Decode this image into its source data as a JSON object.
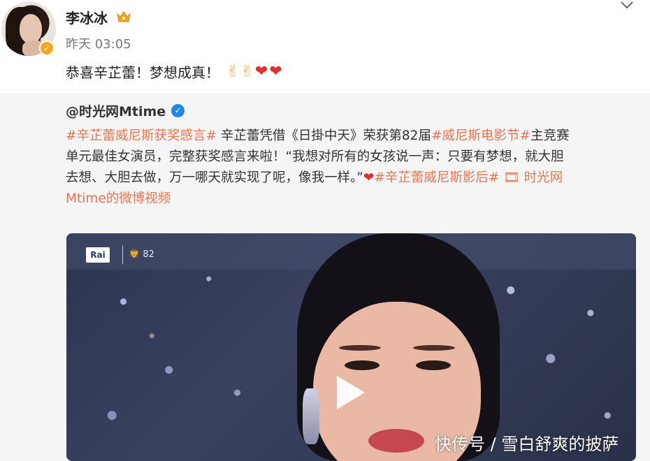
{
  "post": {
    "author": "李冰冰",
    "time": "昨天 03:05",
    "text": "恭喜辛芷蕾！梦想成真！"
  },
  "emojis": [
    "victory-hand",
    "victory-hand",
    "red-heart",
    "red-heart"
  ],
  "repost": {
    "author": "@时光网Mtime",
    "lines": [
      [
        {
          "t": "#辛芷蕾威尼斯获奖感言#",
          "hl": true
        },
        {
          "t": " 辛芷蕾凭借《日掛中天》荣获第82届",
          "hl": false
        },
        {
          "t": "#威尼斯电影节#",
          "hl": true
        },
        {
          "t": "主竞赛",
          "hl": false
        }
      ],
      [
        {
          "t": "单元最佳女演员，完整获奖感言来啦！“我想对所有的女孩说一声：只要有梦想，就大胆",
          "hl": false
        }
      ],
      [
        {
          "t": "去想、大胆去做，万一哪天就实现了呢，像我一样。”",
          "hl": false
        },
        {
          "t": "❤",
          "hl": false,
          "heart": true
        },
        {
          "t": "#辛芷蕾威尼斯影后#",
          "hl": true
        },
        {
          "t": " 🎞 时光网",
          "hl": true
        }
      ],
      [
        {
          "t": "Mtime的微博视频",
          "hl": true
        }
      ]
    ]
  },
  "video": {
    "channel_logo": "Rai",
    "festival_mark": "82"
  },
  "watermark": "快传号 / 雪白舒爽的披萨",
  "colors": {
    "highlight": "#eb7350",
    "heart": "#e0302d",
    "verified_blue": "#1e88e5",
    "vip_gold": "#f5a623"
  }
}
